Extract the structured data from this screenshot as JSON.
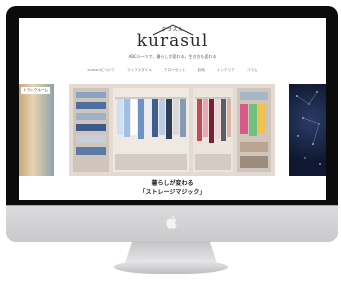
{
  "brand": {
    "small_text": "クラスル",
    "name": "kurasul",
    "tagline": "ABCルーツで、暮らしが変わる。生き方も変わる"
  },
  "nav": {
    "items": [
      {
        "label": "kurasulについて"
      },
      {
        "label": "ライフスタイル"
      },
      {
        "label": "クローゼット"
      },
      {
        "label": "収納"
      },
      {
        "label": "インテリア"
      },
      {
        "label": "コラム"
      }
    ]
  },
  "hero": {
    "left_label": "トランクルーム",
    "caption_title": "暮らしが変わる",
    "caption_subtitle": "「ストレージマジック」"
  },
  "colors": {
    "bezel": "#0b0b0c",
    "screen_bg": "#ffffff",
    "text": "#222222",
    "closet_wood": "#d8cfc7"
  },
  "icons": {
    "logo_roof": "house-roof-icon",
    "monitor_logo": "apple-icon"
  }
}
